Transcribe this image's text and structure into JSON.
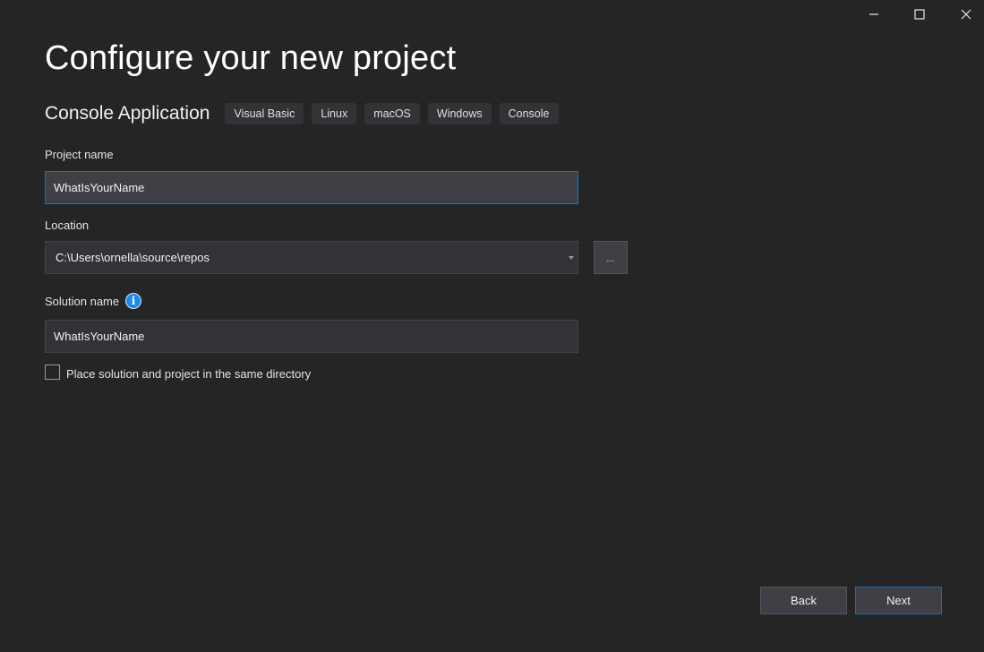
{
  "window_controls": {
    "minimize": "minimize-icon",
    "maximize": "maximize-icon",
    "close": "close-icon"
  },
  "header": {
    "title": "Configure your new project",
    "template_name": "Console Application",
    "tags": [
      "Visual Basic",
      "Linux",
      "macOS",
      "Windows",
      "Console"
    ]
  },
  "form": {
    "project_name": {
      "label": "Project name",
      "value": "WhatIsYourName"
    },
    "location": {
      "label": "Location",
      "value": "C:\\Users\\ornella\\source\\repos",
      "browse_label": "..."
    },
    "solution_name": {
      "label": "Solution name",
      "value": "WhatIsYourName",
      "info_icon": "i"
    },
    "same_directory": {
      "label": "Place solution and project in the same directory",
      "checked": false
    }
  },
  "footer": {
    "back_label": "Back",
    "next_label": "Next"
  },
  "colors": {
    "background": "#252526",
    "accent": "#007acc",
    "input_bg": "#333337",
    "info_icon": "#1e8ae6"
  }
}
